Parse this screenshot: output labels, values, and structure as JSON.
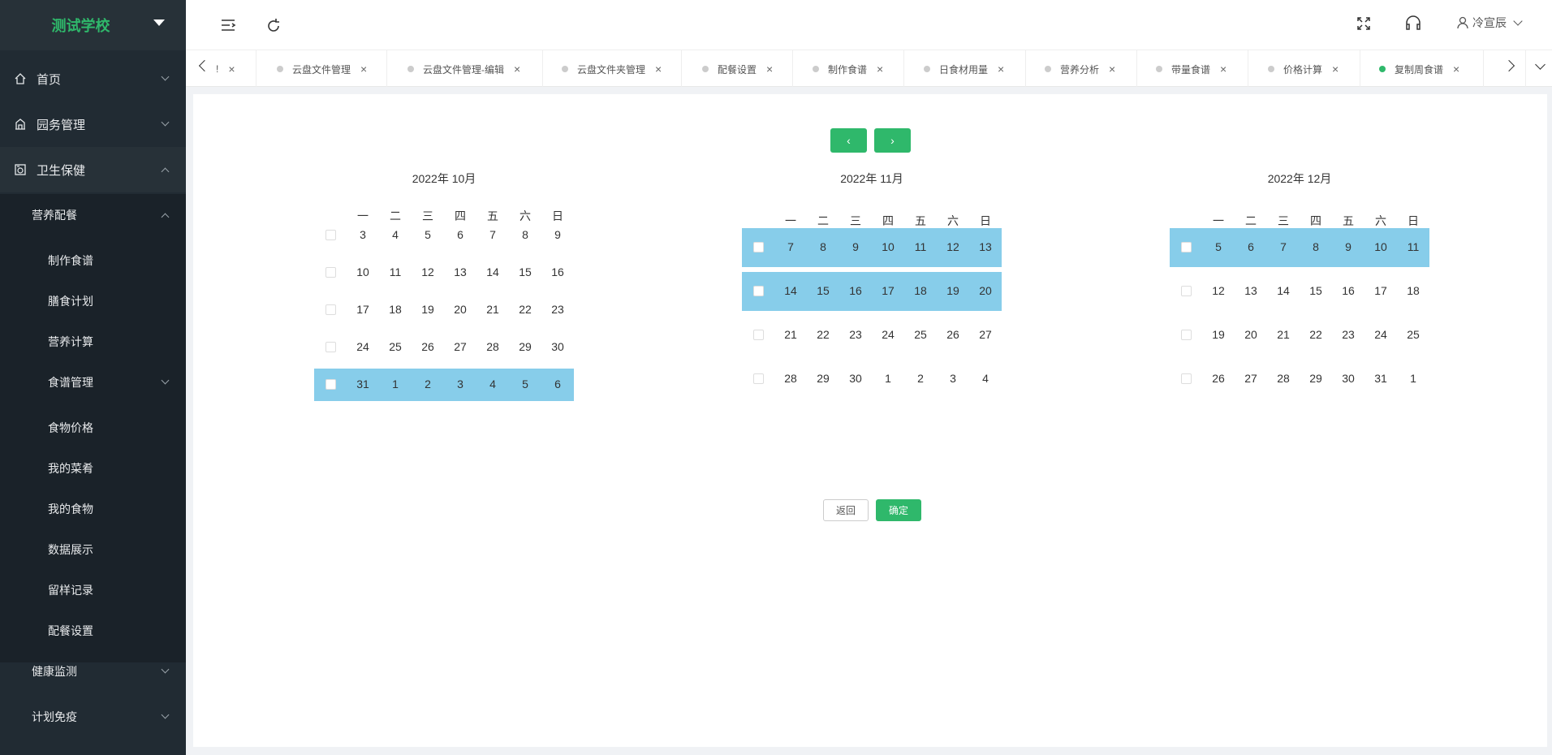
{
  "app": {
    "school": "测试学校",
    "user": "冷宣辰",
    "accent": "#2fb86b",
    "selected_week_color": "#87cdea"
  },
  "sidebar": {
    "home": "首页",
    "campus": "园务管理",
    "health": "卫生保健",
    "nutrition": "营养配餐",
    "items": [
      "制作食谱",
      "膳食计划",
      "营养计算",
      "食谱管理",
      "食物价格",
      "我的菜肴",
      "我的食物",
      "数据展示",
      "留样记录",
      "配餐设置"
    ],
    "health_monitor": "健康监测",
    "vaccine": "计划免疫"
  },
  "tabs": {
    "partial": "!",
    "items": [
      {
        "label": "云盘文件管理",
        "active": false
      },
      {
        "label": "云盘文件管理-编辑",
        "active": false
      },
      {
        "label": "云盘文件夹管理",
        "active": false
      },
      {
        "label": "配餐设置",
        "active": false
      },
      {
        "label": "制作食谱",
        "active": false
      },
      {
        "label": "日食材用量",
        "active": false
      },
      {
        "label": "营养分析",
        "active": false
      },
      {
        "label": "带量食谱",
        "active": false
      },
      {
        "label": "价格计算",
        "active": false
      },
      {
        "label": "复制周食谱",
        "active": true
      }
    ]
  },
  "calendar": {
    "prev": "‹",
    "next": "›",
    "weekdays": [
      "一",
      "二",
      "三",
      "四",
      "五",
      "六",
      "日"
    ],
    "months": [
      {
        "title": "2022年 10月",
        "weeks": [
          {
            "days": [
              "3",
              "4",
              "5",
              "6",
              "7",
              "8",
              "9"
            ],
            "selected": false
          },
          {
            "days": [
              "10",
              "11",
              "12",
              "13",
              "14",
              "15",
              "16"
            ],
            "selected": false
          },
          {
            "days": [
              "17",
              "18",
              "19",
              "20",
              "21",
              "22",
              "23"
            ],
            "selected": false
          },
          {
            "days": [
              "24",
              "25",
              "26",
              "27",
              "28",
              "29",
              "30"
            ],
            "selected": false
          },
          {
            "days": [
              "31",
              "1",
              "2",
              "3",
              "4",
              "5",
              "6"
            ],
            "selected": true
          }
        ]
      },
      {
        "title": "2022年 11月",
        "weeks": [
          {
            "days": [
              "7",
              "8",
              "9",
              "10",
              "11",
              "12",
              "13"
            ],
            "selected": true
          },
          {
            "days": [
              "14",
              "15",
              "16",
              "17",
              "18",
              "19",
              "20"
            ],
            "selected": true
          },
          {
            "days": [
              "21",
              "22",
              "23",
              "24",
              "25",
              "26",
              "27"
            ],
            "selected": false
          },
          {
            "days": [
              "28",
              "29",
              "30",
              "1",
              "2",
              "3",
              "4"
            ],
            "selected": false
          }
        ]
      },
      {
        "title": "2022年 12月",
        "weeks": [
          {
            "days": [
              "5",
              "6",
              "7",
              "8",
              "9",
              "10",
              "11"
            ],
            "selected": true
          },
          {
            "days": [
              "12",
              "13",
              "14",
              "15",
              "16",
              "17",
              "18"
            ],
            "selected": false
          },
          {
            "days": [
              "19",
              "20",
              "21",
              "22",
              "23",
              "24",
              "25"
            ],
            "selected": false
          },
          {
            "days": [
              "26",
              "27",
              "28",
              "29",
              "30",
              "31",
              "1"
            ],
            "selected": false
          }
        ]
      }
    ]
  },
  "actions": {
    "back": "返回",
    "confirm": "确定"
  }
}
